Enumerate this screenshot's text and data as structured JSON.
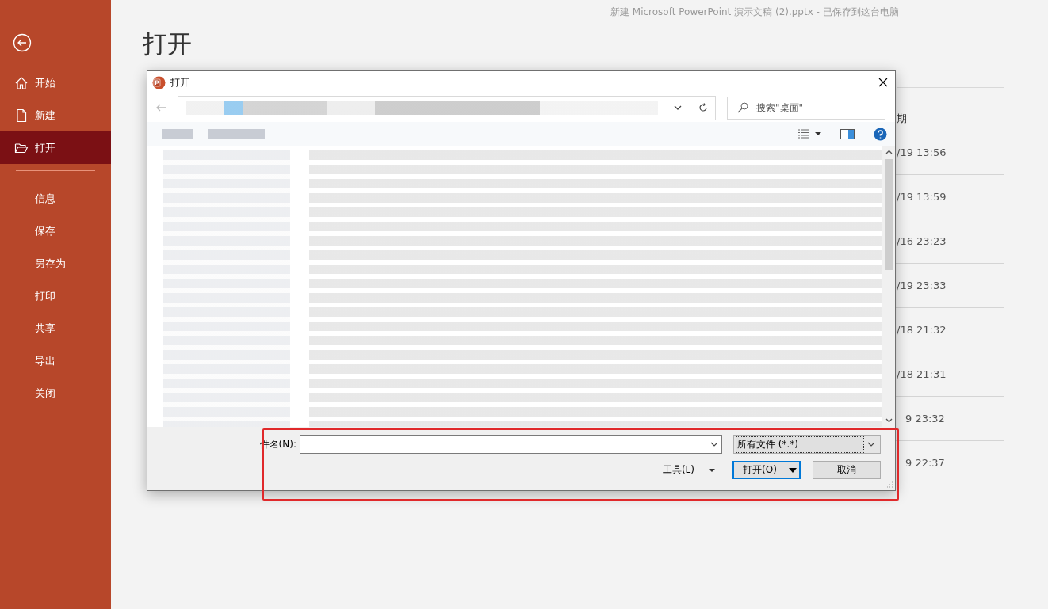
{
  "document_title": "新建 Microsoft PowerPoint 演示文稿 (2).pptx - 已保存到这台电脑",
  "nav": [
    {
      "label": "开始",
      "kind": "home",
      "selected": false
    },
    {
      "label": "新建",
      "kind": "document",
      "selected": false
    },
    {
      "label": "打开",
      "kind": "folder",
      "selected": true
    },
    {
      "label": "信息",
      "kind": "plain",
      "selected": false
    },
    {
      "label": "保存",
      "kind": "plain",
      "selected": false
    },
    {
      "label": "另存为",
      "kind": "plain",
      "selected": false
    },
    {
      "label": "打印",
      "kind": "plain",
      "selected": false
    },
    {
      "label": "共享",
      "kind": "plain",
      "selected": false
    },
    {
      "label": "导出",
      "kind": "plain",
      "selected": false
    },
    {
      "label": "关闭",
      "kind": "plain",
      "selected": false
    }
  ],
  "page_title": "打开",
  "recent": {
    "column_header": "期",
    "dates": [
      {
        "text": "/19 13:56",
        "behind_frame": false
      },
      {
        "text": "/19 13:59",
        "behind_frame": false
      },
      {
        "text": "/16 23:23",
        "behind_frame": false
      },
      {
        "text": "/19 23:33",
        "behind_frame": false
      },
      {
        "text": "/18 21:32",
        "behind_frame": false
      },
      {
        "text": "/18 21:31",
        "behind_frame": false
      },
      {
        "text": "9 23:32",
        "behind_frame": true
      },
      {
        "text": "9 22:37",
        "behind_frame": true
      }
    ]
  },
  "dialog": {
    "title": "打开",
    "search": {
      "placeholder": "搜索\"桌面\""
    },
    "file_name": {
      "label": "件名(N):"
    },
    "file_type": "所有文件 (*.*)",
    "tools": "工具(L)",
    "buttons": [
      {
        "label": "打开(O)",
        "kind": "split",
        "default": true
      },
      {
        "label": "取消",
        "kind": "plain",
        "default": false
      }
    ]
  }
}
